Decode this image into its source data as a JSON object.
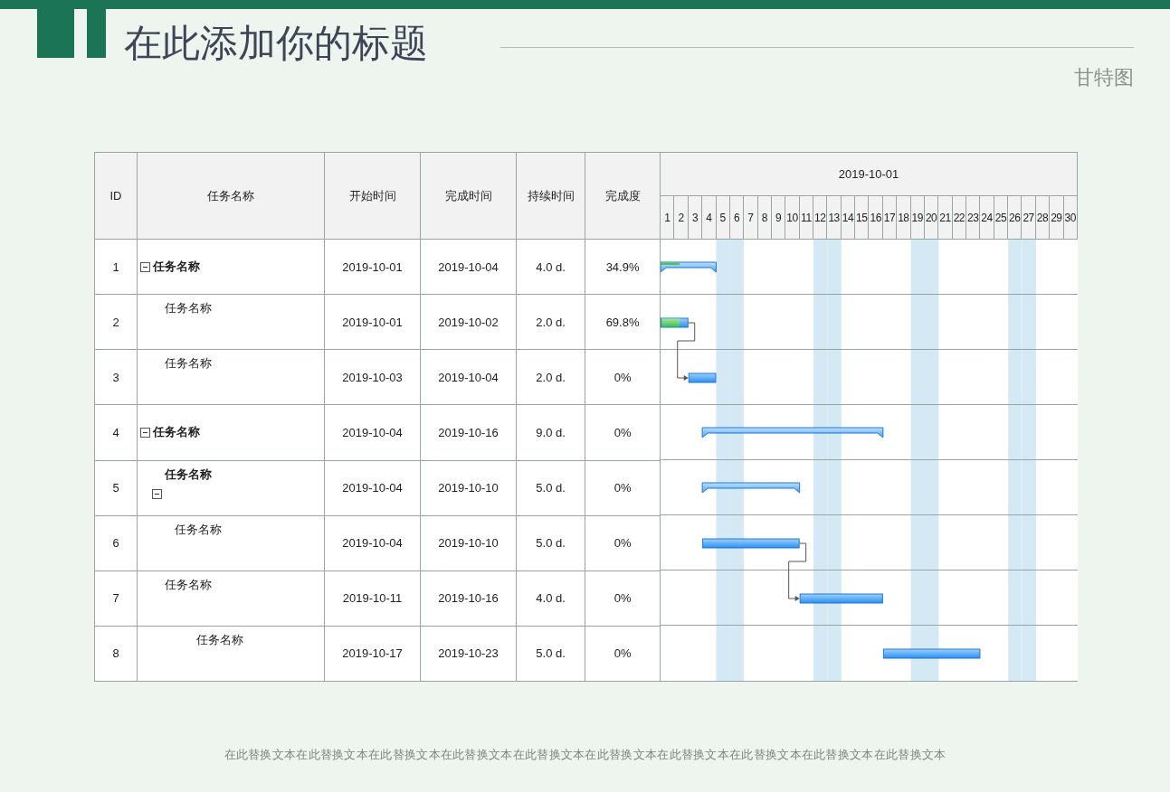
{
  "title": "在此添加你的标题",
  "subtitle": "甘特图",
  "table": {
    "columns": [
      "ID",
      "任务名称",
      "开始时间",
      "完成时间",
      "持续时间",
      "完成度"
    ],
    "timeline_label": "2019-10-01",
    "days": [
      {
        "label": "1",
        "weekend": false
      },
      {
        "label": "2",
        "weekend": false
      },
      {
        "label": "3",
        "weekend": false
      },
      {
        "label": "4",
        "weekend": false
      },
      {
        "label": "5",
        "weekend": true
      },
      {
        "label": "6",
        "weekend": true
      },
      {
        "label": "7",
        "weekend": false
      },
      {
        "label": "8",
        "weekend": false
      },
      {
        "label": "9",
        "weekend": false
      },
      {
        "label": "10",
        "weekend": false
      },
      {
        "label": "11",
        "weekend": false
      },
      {
        "label": "12",
        "weekend": true
      },
      {
        "label": "13",
        "weekend": true
      },
      {
        "label": "14",
        "weekend": false
      },
      {
        "label": "15",
        "weekend": false
      },
      {
        "label": "16",
        "weekend": false
      },
      {
        "label": "17",
        "weekend": false
      },
      {
        "label": "18",
        "weekend": false
      },
      {
        "label": "19",
        "weekend": true
      },
      {
        "label": "20",
        "weekend": true
      },
      {
        "label": "21",
        "weekend": false
      },
      {
        "label": "22",
        "weekend": false
      },
      {
        "label": "23",
        "weekend": false
      },
      {
        "label": "24",
        "weekend": false
      },
      {
        "label": "25",
        "weekend": false
      },
      {
        "label": "26",
        "weekend": true
      },
      {
        "label": "27",
        "weekend": true
      },
      {
        "label": "28",
        "weekend": false
      },
      {
        "label": "29",
        "weekend": false
      },
      {
        "label": "30",
        "weekend": false
      }
    ],
    "tasks": [
      {
        "id": "1",
        "name": "任务名称",
        "kind": "summary",
        "expanded": true,
        "start": "2019-10-01",
        "finish": "2019-10-04",
        "duration": "4.0 d.",
        "complete": "34.9%",
        "level": 0.349,
        "children": [
          {
            "id": "2",
            "name": "任务名称",
            "kind": "task",
            "start": "2019-10-01",
            "finish": "2019-10-02",
            "duration": "2.0 d.",
            "complete": "69.8%",
            "level": 0.698
          },
          {
            "id": "3",
            "name": "任务名称",
            "kind": "task",
            "start": "2019-10-03",
            "finish": "2019-10-04",
            "duration": "2.0 d.",
            "complete": "0%",
            "dependency": true
          }
        ]
      },
      {
        "id": "4",
        "name": "任务名称",
        "kind": "summary",
        "expanded": true,
        "start": "2019-10-04",
        "finish": "2019-10-16",
        "duration": "9.0 d.",
        "complete": "0%",
        "children": [
          {
            "id": "5",
            "name": "任务名称",
            "kind": "summary",
            "expanded": true,
            "start": "2019-10-04",
            "finish": "2019-10-10",
            "duration": "5.0 d.",
            "complete": "0%",
            "children": [
              {
                "id": "6",
                "name": "任务名称",
                "kind": "task",
                "start": "2019-10-04",
                "finish": "2019-10-10",
                "duration": "5.0 d.",
                "complete": "0%"
              }
            ]
          },
          {
            "id": "7",
            "name": "任务名称",
            "kind": "task",
            "start": "2019-10-11",
            "finish": "2019-10-16",
            "duration": "4.0 d.",
            "complete": "0%",
            "dependency": true
          }
        ]
      },
      {
        "id": "8",
        "name": "任务名称",
        "kind": "task",
        "start": "2019-10-17",
        "finish": "2019-10-23",
        "duration": "5.0 d.",
        "complete": "0%"
      }
    ]
  },
  "footer": "在此替换文本在此替换文本在此替换文本在此替换文本在此替换文本在此替换文本在此替换文本在此替换文本在此替换文本在此替换文本"
}
